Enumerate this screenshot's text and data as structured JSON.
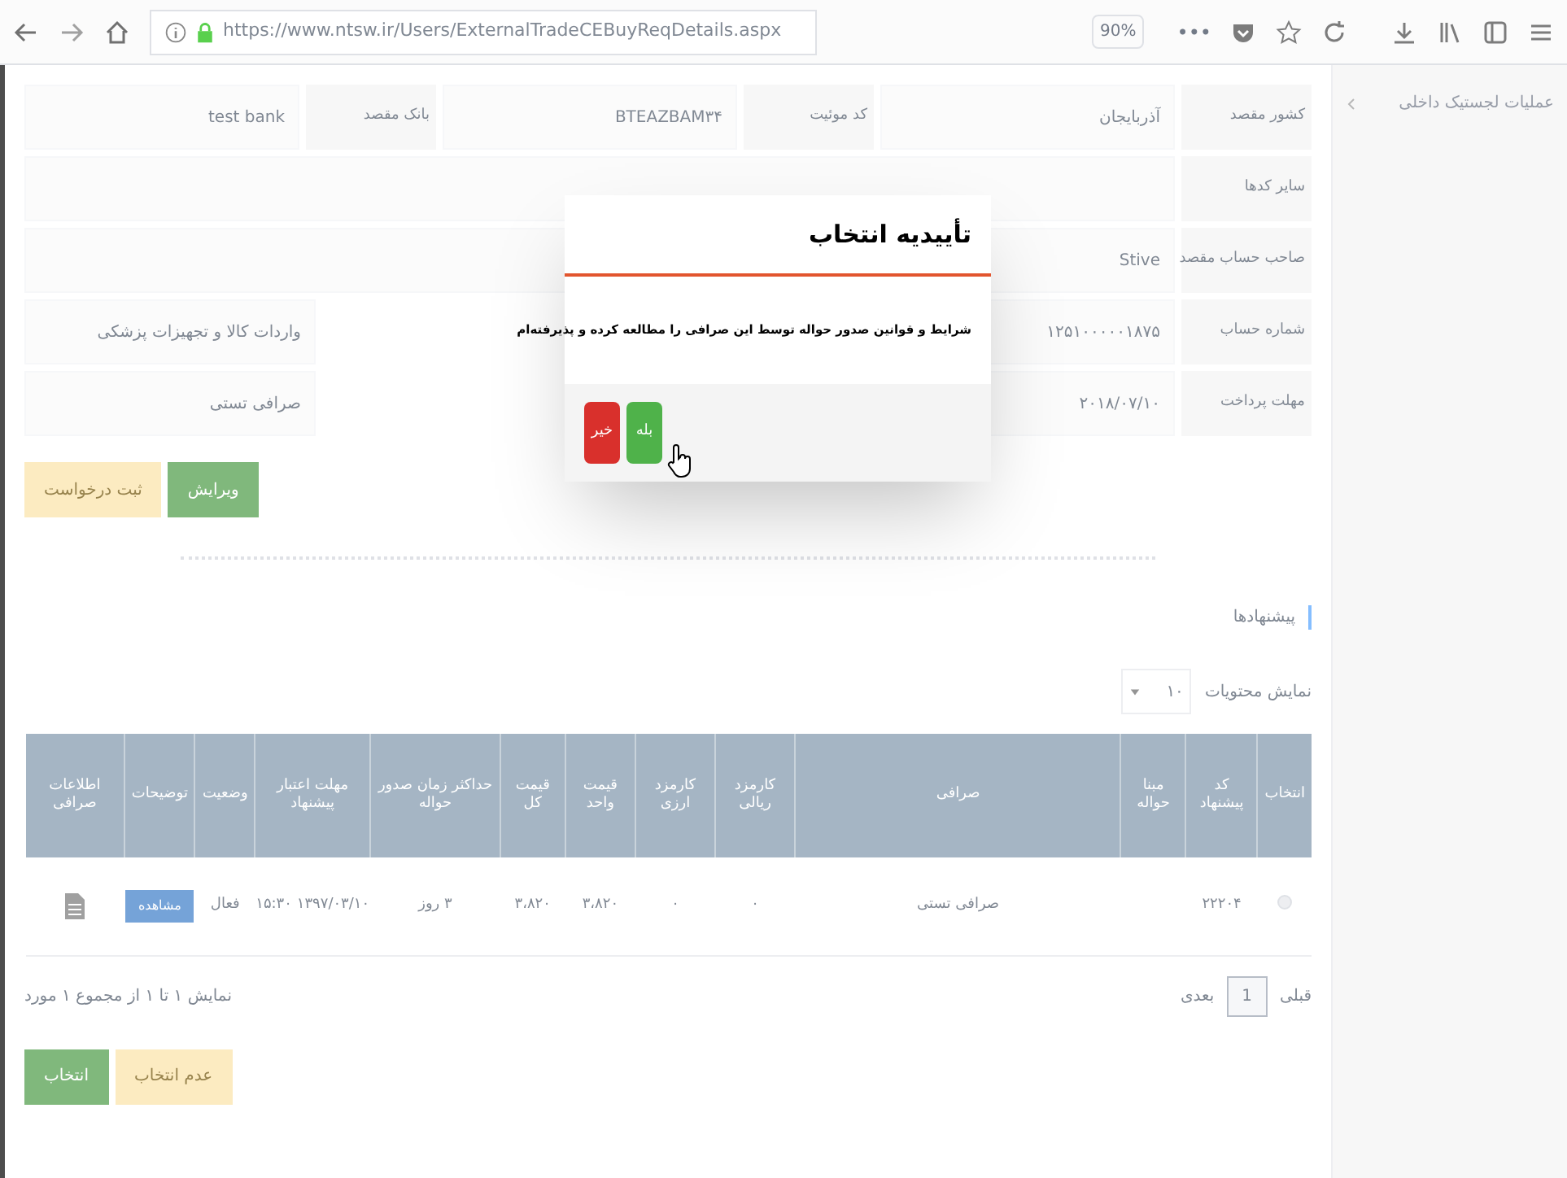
{
  "browser": {
    "url": "https://www.ntsw.ir/Users/ExternalTradeCEBuyReqDetails.aspx",
    "zoom": "90%",
    "more": "•••"
  },
  "sidebar": {
    "items": [
      {
        "label": "عملیات لجستیک داخلی",
        "expanded": false
      }
    ]
  },
  "form": {
    "rows": [
      [
        {
          "label": "کشور مقصد",
          "value": "آذربایجان"
        },
        {
          "label": "کد موئیت",
          "value": "BTEAZBAM۳۴"
        },
        {
          "label": "بانک مقصد",
          "value": "test bank"
        }
      ],
      [
        {
          "label": "سایر کدها"
        }
      ],
      [
        {
          "label": "صاحب حساب مقصد",
          "value": "Stive"
        }
      ],
      [
        {
          "label": "شماره حساب",
          "value": "۱۲۵۱۰۰۰۰۰۱۸۷۵"
        },
        {
          "value": "واردات کالا و تجهیزات پزشکی"
        }
      ],
      [
        {
          "label": "مهلت پرداخت",
          "value": "۲۰۱۸/۰۷/۱۰"
        },
        {
          "value": "صرافی تستی"
        }
      ]
    ]
  },
  "form_buttons": [
    {
      "label": "ویرایش",
      "kind": "success"
    },
    {
      "label": "ثبت درخواست",
      "kind": "warning"
    }
  ],
  "section_title": "پیشنهادها",
  "page_length": {
    "label": "نمایش محتویات",
    "value": "۱۰"
  },
  "table": {
    "columns": [
      "انتخاب",
      "کد پیشنهاد",
      "مبنا حواله",
      "صرافی",
      "کارمزد ریالی",
      "کارمزد ارزی",
      "قیمت واحد",
      "قیمت کل",
      "حداکثر زمان صدور حواله",
      "مهلت اعتبار پیشنهاد",
      "وضعیت",
      "توضیحات",
      "اطلاعات صرافی"
    ],
    "rows": [
      {
        "selected": false,
        "cells": [
          {
            "kind": "radio"
          },
          {
            "kind": "text",
            "text": "۲۲۲۰۴"
          },
          {
            "kind": "blank"
          },
          {
            "kind": "text",
            "text": "صرافی تستی"
          },
          {
            "kind": "text",
            "text": "۰"
          },
          {
            "kind": "text",
            "text": "۰"
          },
          {
            "kind": "text",
            "text": "۳،۸۲۰"
          },
          {
            "kind": "text",
            "text": "۳،۸۲۰"
          },
          {
            "kind": "text",
            "text": "۳ روز"
          },
          {
            "kind": "text",
            "text": "۱۳۹۷/۰۳/۱۰ ۱۵:۳۰"
          },
          {
            "kind": "text",
            "text": "فعال"
          },
          {
            "kind": "button",
            "text": "مشاهده"
          },
          {
            "kind": "icon"
          }
        ]
      }
    ]
  },
  "pagination": {
    "previous": "قبلی",
    "pages": [
      {
        "label": "1",
        "selected": true
      }
    ],
    "next": "بعدی"
  },
  "info": "نمایش ۱ تا ۱ از مجموع ۱ مورد",
  "action_buttons": [
    {
      "label": "عدم انتخاب",
      "kind": "warning"
    },
    {
      "label": "انتخاب",
      "kind": "success"
    }
  ],
  "dialog": {
    "title": "تأییدیه انتخاب",
    "message": "شرایط و قوانین صدور حواله توسط این صرافی را مطالعه کرده و پذیرفته‌ام",
    "buttons": [
      {
        "label": "بله",
        "kind": "success"
      },
      {
        "label": "خیر",
        "kind": "danger"
      }
    ]
  }
}
